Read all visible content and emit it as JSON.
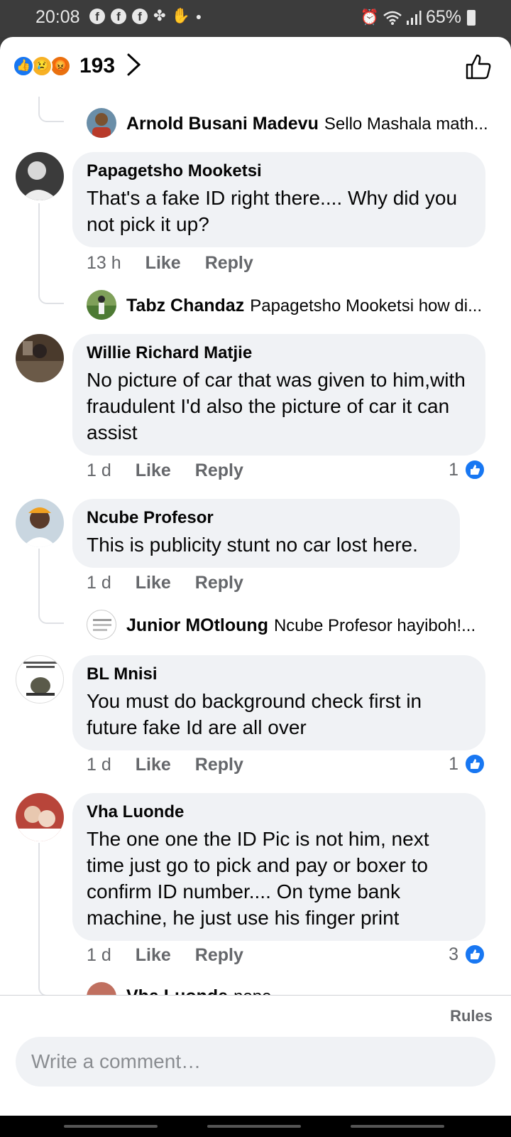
{
  "status_bar": {
    "time": "20:08",
    "battery": "65%",
    "icons": [
      "facebook-icon",
      "facebook-icon",
      "facebook-icon",
      "pinwheel-icon",
      "hand-icon",
      "dot-icon",
      "alarm-icon",
      "wifi-icon",
      "signal-icon",
      "battery-icon"
    ]
  },
  "reactions": {
    "count": "193",
    "types": [
      "like",
      "sad",
      "angry"
    ]
  },
  "comments": [
    {
      "reply_preview": {
        "name": "Arnold Busani Madevu",
        "text": "Sello Mashala math..."
      }
    },
    {
      "name": "Papagetsho Mooketsi",
      "text": "That's a fake ID right there.... Why did you not pick it up?",
      "time": "13 h",
      "like": "Like",
      "reply": "Reply",
      "reply_preview": {
        "name": "Tabz Chandaz",
        "text": "Papagetsho Mooketsi how di..."
      }
    },
    {
      "name": "Willie Richard Matjie",
      "text": "No picture of car that was given to him,with fraudulent I'd also the picture of car it can assist",
      "time": "1 d",
      "like": "Like",
      "reply": "Reply",
      "likes": "1"
    },
    {
      "name": "Ncube Profesor",
      "text": "This is publicity stunt no car lost here.",
      "time": "1 d",
      "like": "Like",
      "reply": "Reply",
      "reply_preview": {
        "name": "Junior MOtloung",
        "text": "Ncube Profesor hayiboh!..."
      }
    },
    {
      "name": "BL Mnisi",
      "text": "You  must do background check first in future  fake Id are all over",
      "time": "1 d",
      "like": "Like",
      "reply": "Reply",
      "likes": "1"
    },
    {
      "name": "Vha Luonde",
      "text": "The one one the ID Pic is not him, next time just go to pick and pay  or boxer to confirm ID number.... On tyme bank machine, he just use his finger print",
      "time": "1 d",
      "like": "Like",
      "reply": "Reply",
      "likes": "3",
      "reply_preview": {
        "name": "Vha Luonde",
        "text": "nope"
      }
    }
  ],
  "footer": {
    "rules": "Rules",
    "input_placeholder": "Write a comment…"
  },
  "colors": {
    "accent": "#1877f2",
    "bubble": "#f0f2f5",
    "meta": "#65676b"
  }
}
